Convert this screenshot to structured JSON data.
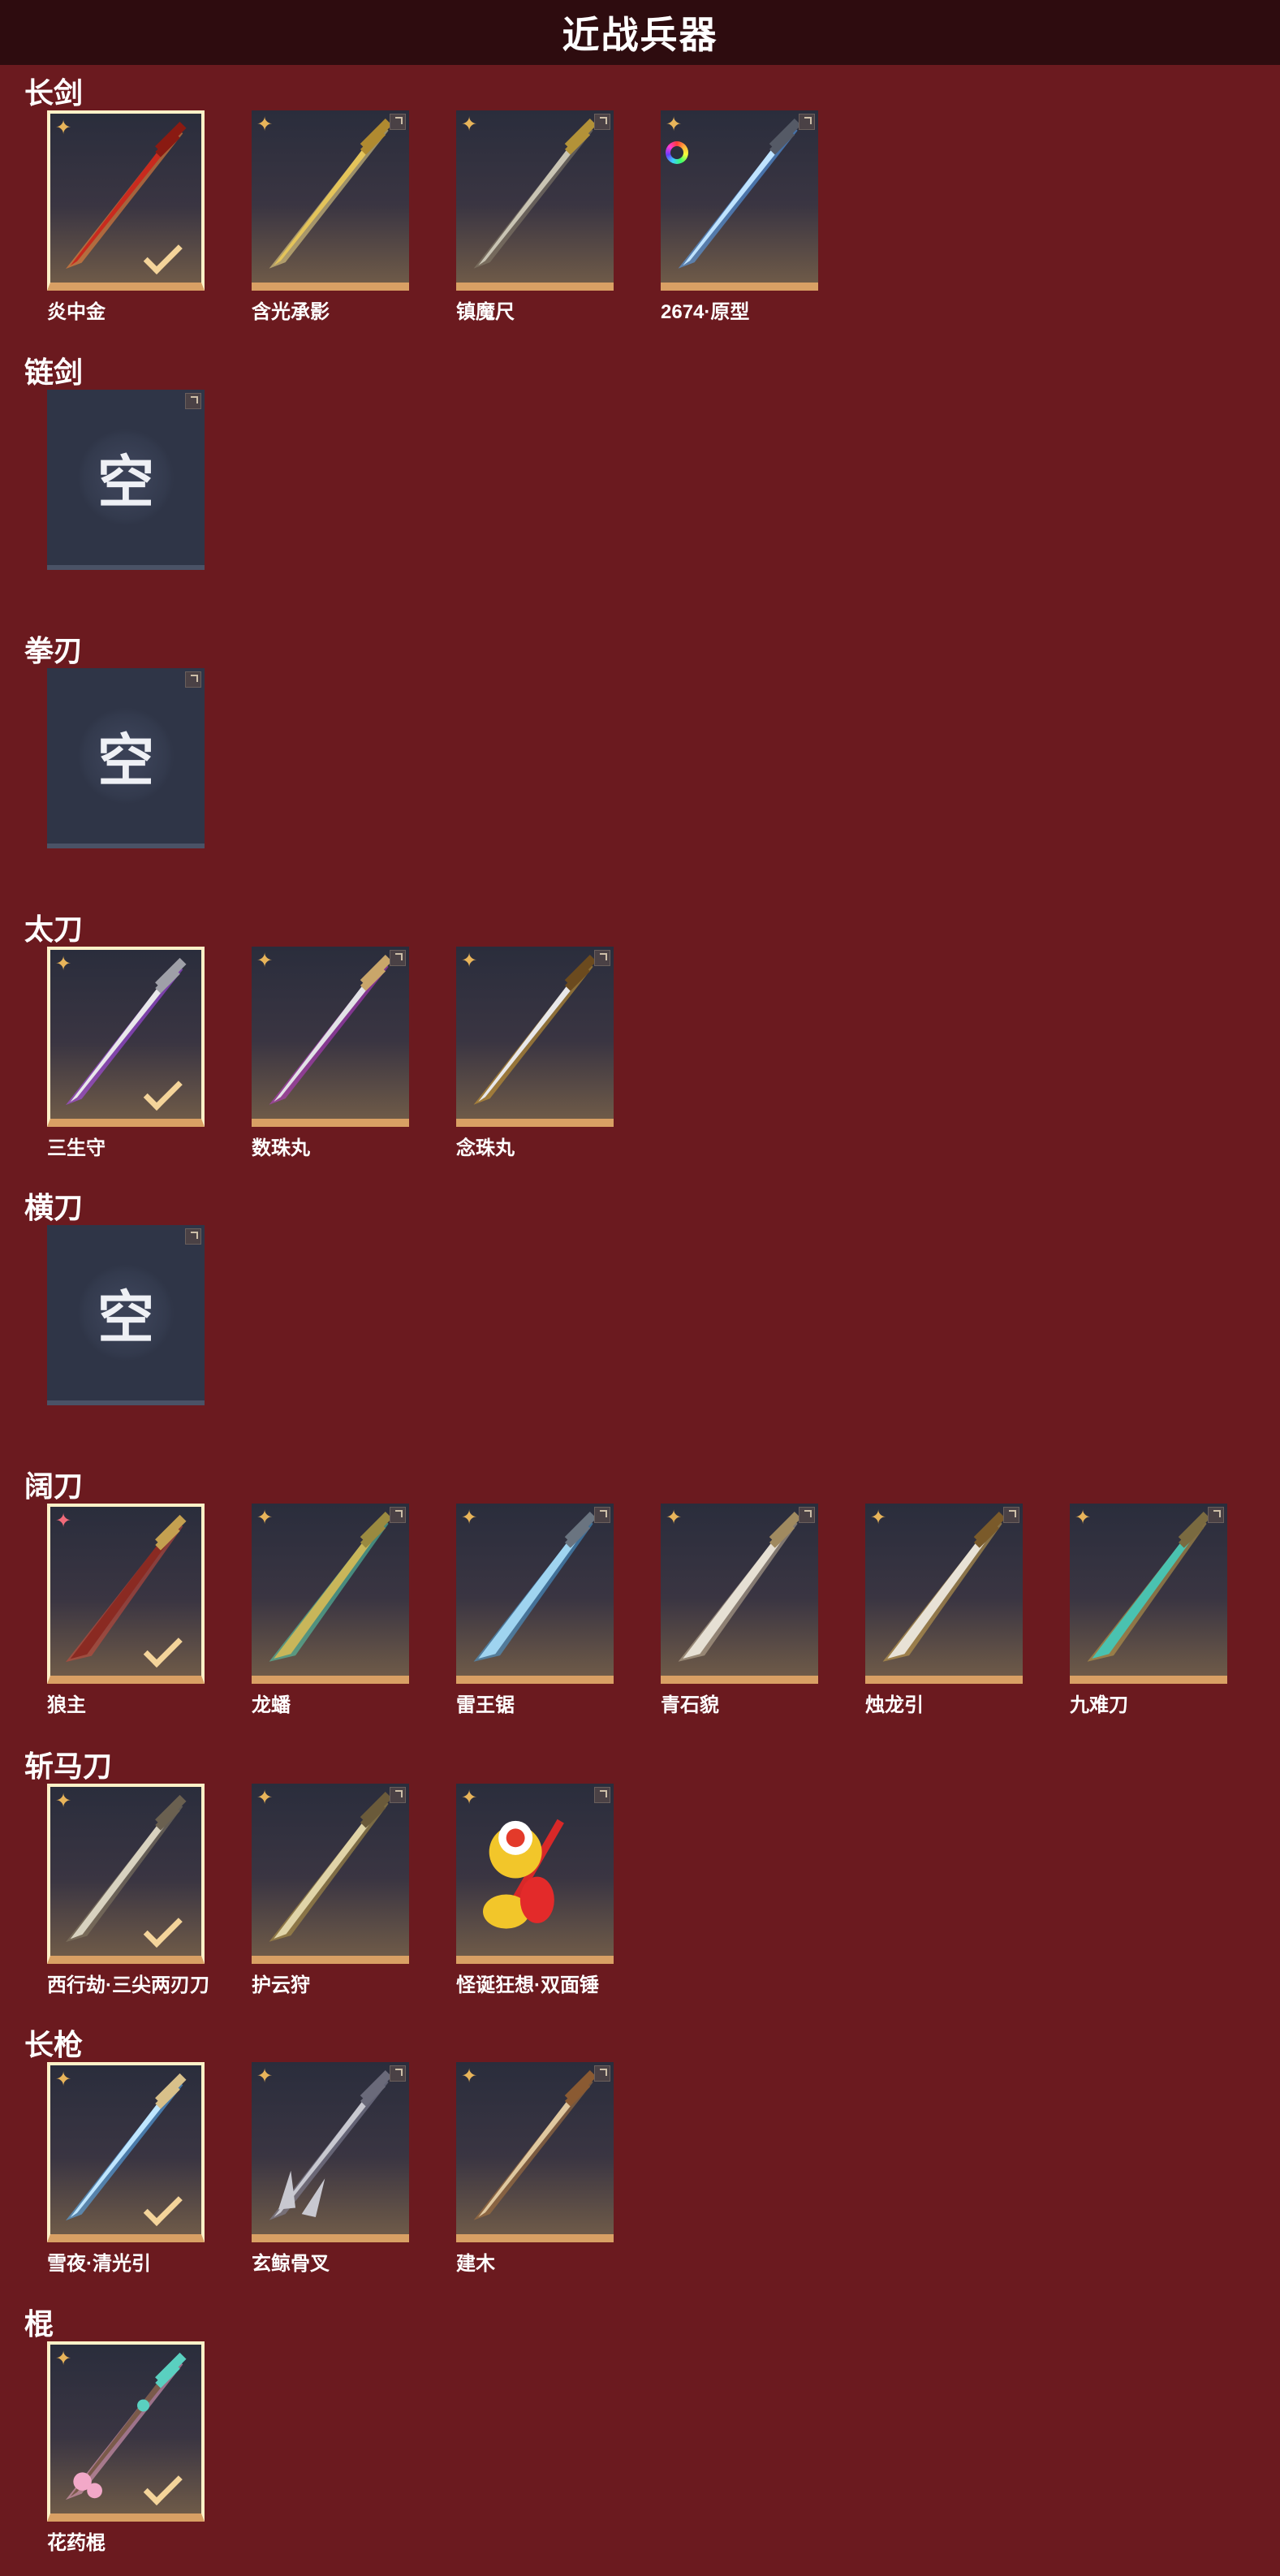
{
  "header": {
    "title": "近战兵器"
  },
  "empty_text": "空",
  "colors": {
    "background": "#6b1a1f",
    "header": "#2e0c0f",
    "card_border": "#d9a064",
    "empty_card": "#2f3547"
  },
  "sections": [
    {
      "title": "长剑",
      "items": [
        {
          "name": "炎中金",
          "selected": true,
          "rarity": "gold-star-icon",
          "weapon": "red-flame-sword"
        },
        {
          "name": "含光承影",
          "selected": false,
          "rarity": "gold-star-icon",
          "weapon": "gold-sword"
        },
        {
          "name": "镇魔尺",
          "selected": false,
          "rarity": "gold-star-icon",
          "weapon": "silver-gold-sword"
        },
        {
          "name": "2674·原型",
          "selected": false,
          "rarity": "gold-star-icon",
          "weapon": "light-saber",
          "badge": "rainbow-ring-icon"
        }
      ]
    },
    {
      "title": "链剑",
      "items": [
        {
          "empty": true
        }
      ]
    },
    {
      "title": "拳刃",
      "items": [
        {
          "empty": true
        }
      ]
    },
    {
      "title": "太刀",
      "items": [
        {
          "name": "三生守",
          "selected": true,
          "rarity": "gold-star-icon",
          "weapon": "white-katana"
        },
        {
          "name": "数珠丸",
          "selected": false,
          "rarity": "gold-star-icon",
          "weapon": "purple-katana"
        },
        {
          "name": "念珠丸",
          "selected": false,
          "rarity": "gold-star-icon",
          "weapon": "gold-katana"
        }
      ]
    },
    {
      "title": "横刀",
      "items": [
        {
          "empty": true
        }
      ]
    },
    {
      "title": "阔刀",
      "items": [
        {
          "name": "狼主",
          "selected": true,
          "rarity": "red-star-icon",
          "weapon": "red-broadblade"
        },
        {
          "name": "龙蟠",
          "selected": false,
          "rarity": "gold-star-icon",
          "weapon": "jade-broadblade"
        },
        {
          "name": "雷王锯",
          "selected": false,
          "rarity": "gold-star-icon",
          "weapon": "ice-broadblade"
        },
        {
          "name": "青石貌",
          "selected": false,
          "rarity": "gold-star-icon",
          "weapon": "white-broadblade"
        },
        {
          "name": "烛龙引",
          "selected": false,
          "rarity": "gold-star-icon",
          "weapon": "dragon-broadblade"
        },
        {
          "name": "九难刀",
          "selected": false,
          "rarity": "gold-star-icon",
          "weapon": "teal-broadblade"
        }
      ]
    },
    {
      "title": "斩马刀",
      "items": [
        {
          "name": "西行劫·三尖两刃刀",
          "selected": true,
          "rarity": "gold-star-icon",
          "weapon": "trident-glaive"
        },
        {
          "name": "护云狩",
          "selected": false,
          "rarity": "gold-star-icon",
          "weapon": "gold-glaive"
        },
        {
          "name": "怪诞狂想·双面锤",
          "selected": false,
          "rarity": "gold-star-icon",
          "weapon": "toy-hammer"
        }
      ]
    },
    {
      "title": "长枪",
      "items": [
        {
          "name": "雪夜·清光引",
          "selected": true,
          "rarity": "gold-star-icon",
          "weapon": "ice-spear"
        },
        {
          "name": "玄鲸骨叉",
          "selected": false,
          "rarity": "gold-star-icon",
          "weapon": "bone-trident"
        },
        {
          "name": "建木",
          "selected": false,
          "rarity": "gold-star-icon",
          "weapon": "wood-spear"
        }
      ]
    },
    {
      "title": "棍",
      "items": [
        {
          "name": "花药棍",
          "selected": true,
          "rarity": "gold-star-icon",
          "weapon": "flower-staff"
        }
      ]
    }
  ]
}
